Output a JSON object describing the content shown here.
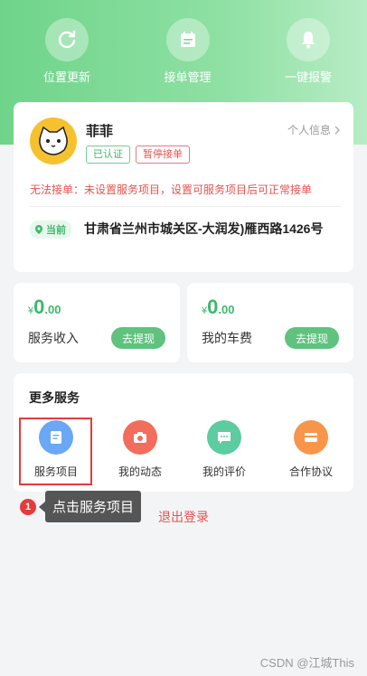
{
  "top_actions": [
    {
      "label": "位置更新",
      "icon": "refresh-icon"
    },
    {
      "label": "接单管理",
      "icon": "calendar-icon"
    },
    {
      "label": "一键报警",
      "icon": "bell-icon"
    }
  ],
  "profile": {
    "name": "菲菲",
    "badge_verified": "已认证",
    "badge_paused": "暂停接单",
    "personal_info_link": "个人信息",
    "warning": "无法接单：未设置服务项目，设置可服务项目后可正常接单",
    "location_tag": "当前",
    "address": "甘肃省兰州市城关区-大润发)雁西路1426号"
  },
  "money": {
    "income": {
      "yen": "¥",
      "int": "0",
      "dec": ".00",
      "label": "服务收入",
      "button": "去提现"
    },
    "fare": {
      "yen": "¥",
      "int": "0",
      "dec": ".00",
      "label": "我的车费",
      "button": "去提现"
    }
  },
  "services": {
    "title": "更多服务",
    "items": [
      {
        "label": "服务项目",
        "icon": "document-icon",
        "color": "#6aa7f5"
      },
      {
        "label": "我的动态",
        "icon": "camera-icon",
        "color": "#f26d5b"
      },
      {
        "label": "我的评价",
        "icon": "chat-icon",
        "color": "#5dcca0"
      },
      {
        "label": "合作协议",
        "icon": "card-icon",
        "color": "#f7954a"
      }
    ]
  },
  "guide": {
    "step": "1",
    "tooltip": "点击服务项目"
  },
  "logout": "退出登录",
  "watermark": "CSDN @江城This",
  "colors": {
    "brand_green": "#6fd48a",
    "warning_red": "#e5544f",
    "highlight_red": "#e53b3b"
  }
}
